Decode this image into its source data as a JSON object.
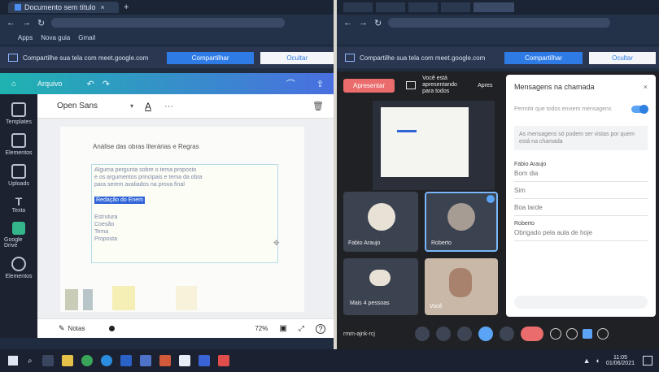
{
  "left_window": {
    "tab_title": "Documento sem título",
    "bookmarks": [
      "Apps",
      "Nova guia",
      "Gmail"
    ],
    "banner": {
      "text": "Compartilhe sua tela com meet.google.com",
      "share_button": "Compartilhar",
      "hide_button": "Ocultar"
    },
    "canva": {
      "topbar_label": "Arquivo",
      "font_name": "Open Sans",
      "sidebar": [
        "Templates",
        "Elementos",
        "Uploads",
        "Texto",
        "Google Drive",
        "Elementos"
      ],
      "doc_title": "Análise das obras literárias e Regras",
      "text_lines": [
        "Alguma pergunta sobre o tema proposto",
        "e os argumentos principais e tema da obra",
        "para serem avaliados na prova final"
      ],
      "highlight": "Redação do Enem",
      "list_items": [
        "Estrutura",
        "Coesão",
        "Tema",
        "Proposta"
      ],
      "notes_label": "Notas",
      "zoom": "72%"
    }
  },
  "right_window": {
    "banner": {
      "text": "Compartilhe sua tela com meet.google.com",
      "share_button": "Compartilhar",
      "hide_button": "Ocultar"
    },
    "meet": {
      "present_button": "Apresentar",
      "presenting_label": "Você está apresentando para todos",
      "present_short": "Apres",
      "participants": [
        {
          "name": "Fabio Araujo"
        },
        {
          "name": "Roberto"
        },
        {
          "name": "Mais 4 pessoas"
        },
        {
          "name": "Você"
        }
      ],
      "meeting_code": "rmm-ajnk-rcj",
      "chat_panel": {
        "title": "Mensagens na chamada",
        "toggle_label": "Permitir que todos enviem mensagens",
        "info_text": "As mensagens só podem ser vistas por quem está na chamada",
        "messages": [
          {
            "sender": "Fabio Araujo",
            "lines": [
              "Bom dia",
              "Sim",
              "Boa tarde"
            ]
          },
          {
            "sender": "Roberto",
            "lines": [
              "Obrigado pela aula de hoje"
            ]
          }
        ]
      }
    }
  },
  "taskbar": {
    "time": "11:05",
    "date": "01/06/2021"
  }
}
